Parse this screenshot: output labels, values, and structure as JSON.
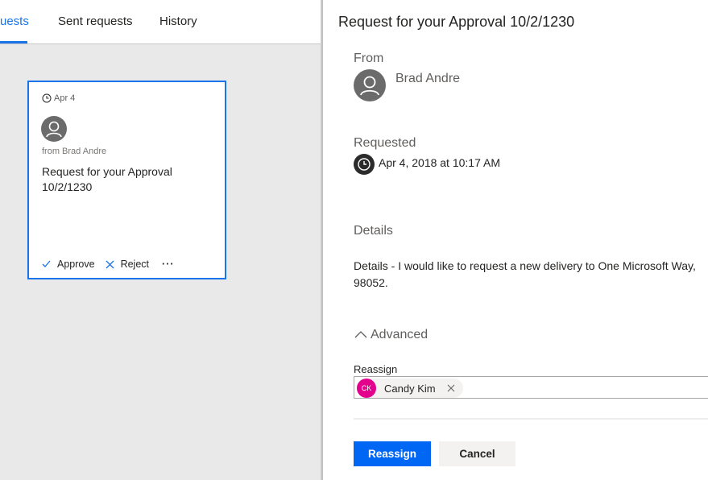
{
  "tabs": [
    {
      "label": "uests",
      "active": true
    },
    {
      "label": "Sent requests",
      "active": false
    },
    {
      "label": "History",
      "active": false
    }
  ],
  "card": {
    "date": "Apr 4",
    "from": "from Brad Andre",
    "title": "Request for your Approval 10/2/1230",
    "approve_label": "Approve",
    "reject_label": "Reject",
    "more_label": "···"
  },
  "detail": {
    "title": "Request for your Approval 10/2/1230",
    "from_label": "From",
    "from_name": "Brad Andre",
    "requested_label": "Requested",
    "requested_time": "Apr 4, 2018 at 10:17 AM",
    "details_label": "Details",
    "details_text_line1": "Details - I would like to request a new delivery to One Microsoft Way,",
    "details_text_line2": "98052.",
    "advanced_label": "Advanced",
    "reassign_label": "Reassign",
    "reassignee": {
      "initials": "CK",
      "name": "Candy Kim",
      "color": "#e3008c"
    },
    "reassign_button": "Reassign",
    "cancel_button": "Cancel"
  },
  "colors": {
    "accent": "#1a73e8",
    "primary_button": "#0067f4"
  }
}
